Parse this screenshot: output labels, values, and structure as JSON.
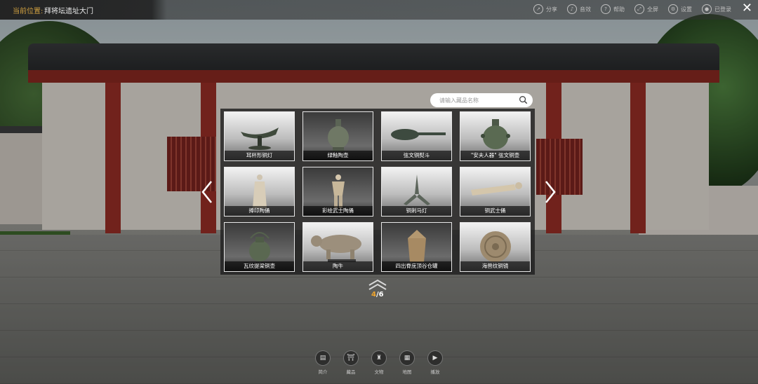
{
  "location": {
    "label": "当前位置:",
    "value": "拜将坛遗址大门"
  },
  "toolbar": [
    {
      "label": "分享",
      "icon": "share-icon"
    },
    {
      "label": "音效",
      "icon": "sound-icon"
    },
    {
      "label": "帮助",
      "icon": "help-icon"
    },
    {
      "label": "全屏",
      "icon": "fullscreen-icon"
    },
    {
      "label": "设置",
      "icon": "settings-icon"
    },
    {
      "label": "已登录",
      "icon": "user-icon"
    }
  ],
  "search": {
    "placeholder": "请输入藏品名称",
    "icon": "search-icon"
  },
  "gallery": {
    "items": [
      {
        "name": "耳杯形铜灯"
      },
      {
        "name": "绿釉陶壶"
      },
      {
        "name": "弦文铜熨斗"
      },
      {
        "name": "\"安夫人器\" 弦文铜壶"
      },
      {
        "name": "捧印陶俑"
      },
      {
        "name": "彩绘武士陶俑"
      },
      {
        "name": "铜刺马灯"
      },
      {
        "name": "铜武士俑"
      },
      {
        "name": "瓦纹提梁铜壶"
      },
      {
        "name": "陶牛"
      },
      {
        "name": "四出脊庑顶谷仓罐"
      },
      {
        "name": "海兽纹铜镜"
      }
    ],
    "page": {
      "current": "4",
      "total": "/6"
    }
  },
  "dock": [
    {
      "label": "简介",
      "icon": "book-icon"
    },
    {
      "label": "藏品",
      "icon": "collection-icon"
    },
    {
      "label": "文物",
      "icon": "artifact-icon"
    },
    {
      "label": "地图",
      "icon": "map-icon"
    },
    {
      "label": "播放",
      "icon": "play-icon"
    }
  ],
  "colors": {
    "accent": "#f1a52c",
    "location_label": "#d0a040"
  }
}
